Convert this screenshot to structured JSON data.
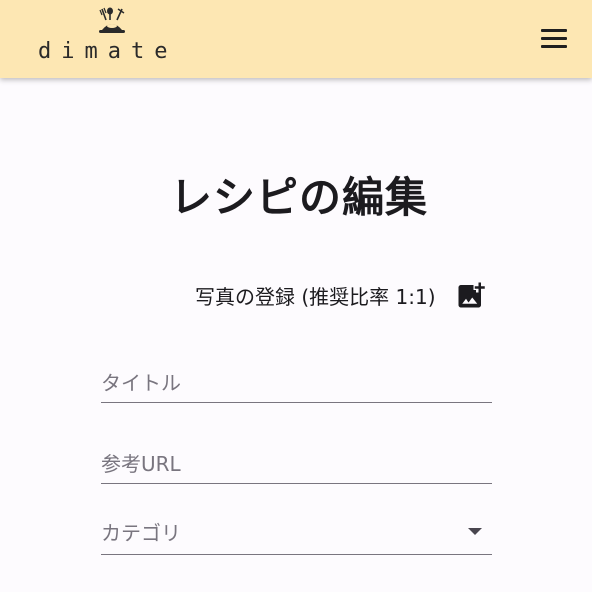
{
  "header": {
    "app_name": "dimate",
    "logo_icon": "dining-plate-icon",
    "menu_icon": "hamburger-menu-icon",
    "background_color": "#fde7b3"
  },
  "main": {
    "page_title": "レシピの編集",
    "photo": {
      "label": "写真の登録 (推奨比率 1:1)",
      "icon": "add-photo-icon"
    },
    "fields": {
      "title_placeholder": "タイトル",
      "url_placeholder": "参考URL",
      "category_placeholder": "カテゴリ"
    }
  }
}
